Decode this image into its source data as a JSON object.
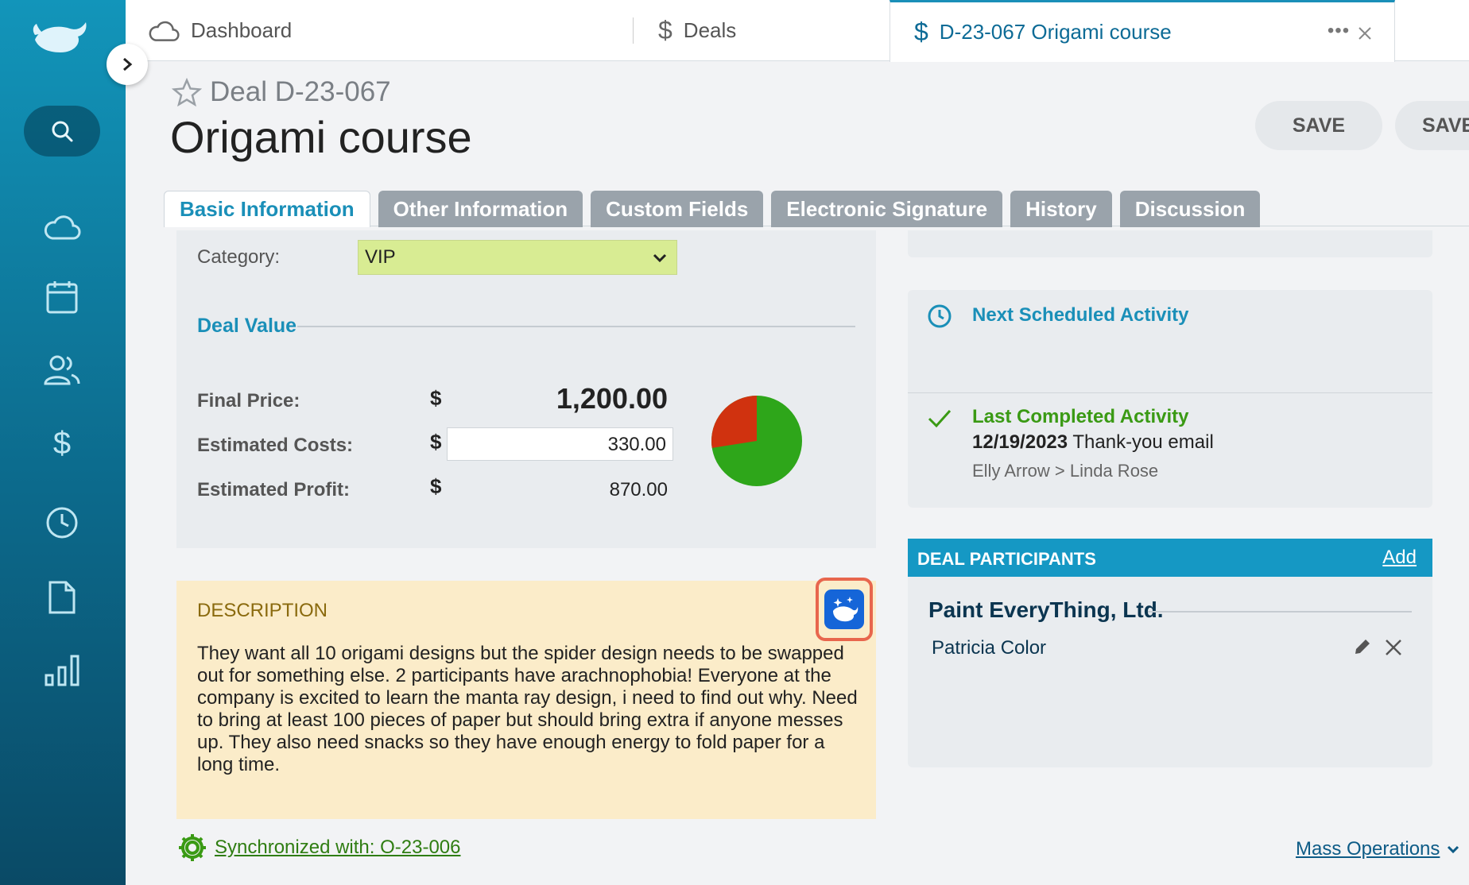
{
  "tabs": [
    {
      "label": "Dashboard",
      "icon": "cloud-icon"
    },
    {
      "label": "Deals",
      "icon": "dollar-icon"
    },
    {
      "label": "D-23-067 Origami course",
      "icon": "dollar-icon"
    }
  ],
  "tabs_more": "•••",
  "header": {
    "deal_id": "Deal D-23-067",
    "title": "Origami course",
    "save_label": "SAVE",
    "save_close_label": "SAVE"
  },
  "form_tabs": [
    "Basic Information",
    "Other Information",
    "Custom Fields",
    "Electronic Signature",
    "History",
    "Discussion"
  ],
  "basic": {
    "category_label": "Category:",
    "category_value": "VIP",
    "deal_value_title": "Deal Value",
    "final_price_label": "Final Price:",
    "final_price": "1,200.00",
    "estimated_costs_label": "Estimated Costs:",
    "estimated_costs": "330.00",
    "estimated_profit_label": "Estimated Profit:",
    "estimated_profit": "870.00",
    "currency": "$",
    "pie": {
      "costs_fraction": 0.275,
      "costs_color": "#d0320f",
      "profit_color": "#2ea61a"
    }
  },
  "description": {
    "title": "DESCRIPTION",
    "text": "They want all 10 origami designs but the spider design needs to be swapped out for something else. 2 participants have arachnophobia! Everyone at the company is excited to learn the manta ray design, i need to find out why. Need to bring at least 100 pieces of paper but should bring extra if anyone messes up. They also need snacks so they have enough energy to fold paper for a long time."
  },
  "sync": {
    "label": "Synchronized with: O-23-006"
  },
  "mass_operations": "Mass Operations",
  "activities": {
    "next_title": "Next Scheduled Activity",
    "last_title": "Last Completed Activity",
    "last_date": "12/19/2023",
    "last_subject": "Thank-you email",
    "last_people": "Elly Arrow > Linda Rose"
  },
  "participants": {
    "title": "DEAL PARTICIPANTS",
    "add_label": "Add",
    "company": "Paint EveryThing, Ltd.",
    "person": "Patricia Color"
  },
  "colors": {
    "accent": "#1a8fb8",
    "sidebar_top": "#1295ba",
    "sidebar_bottom": "#0a4a66",
    "highlight": "#e8664d"
  }
}
